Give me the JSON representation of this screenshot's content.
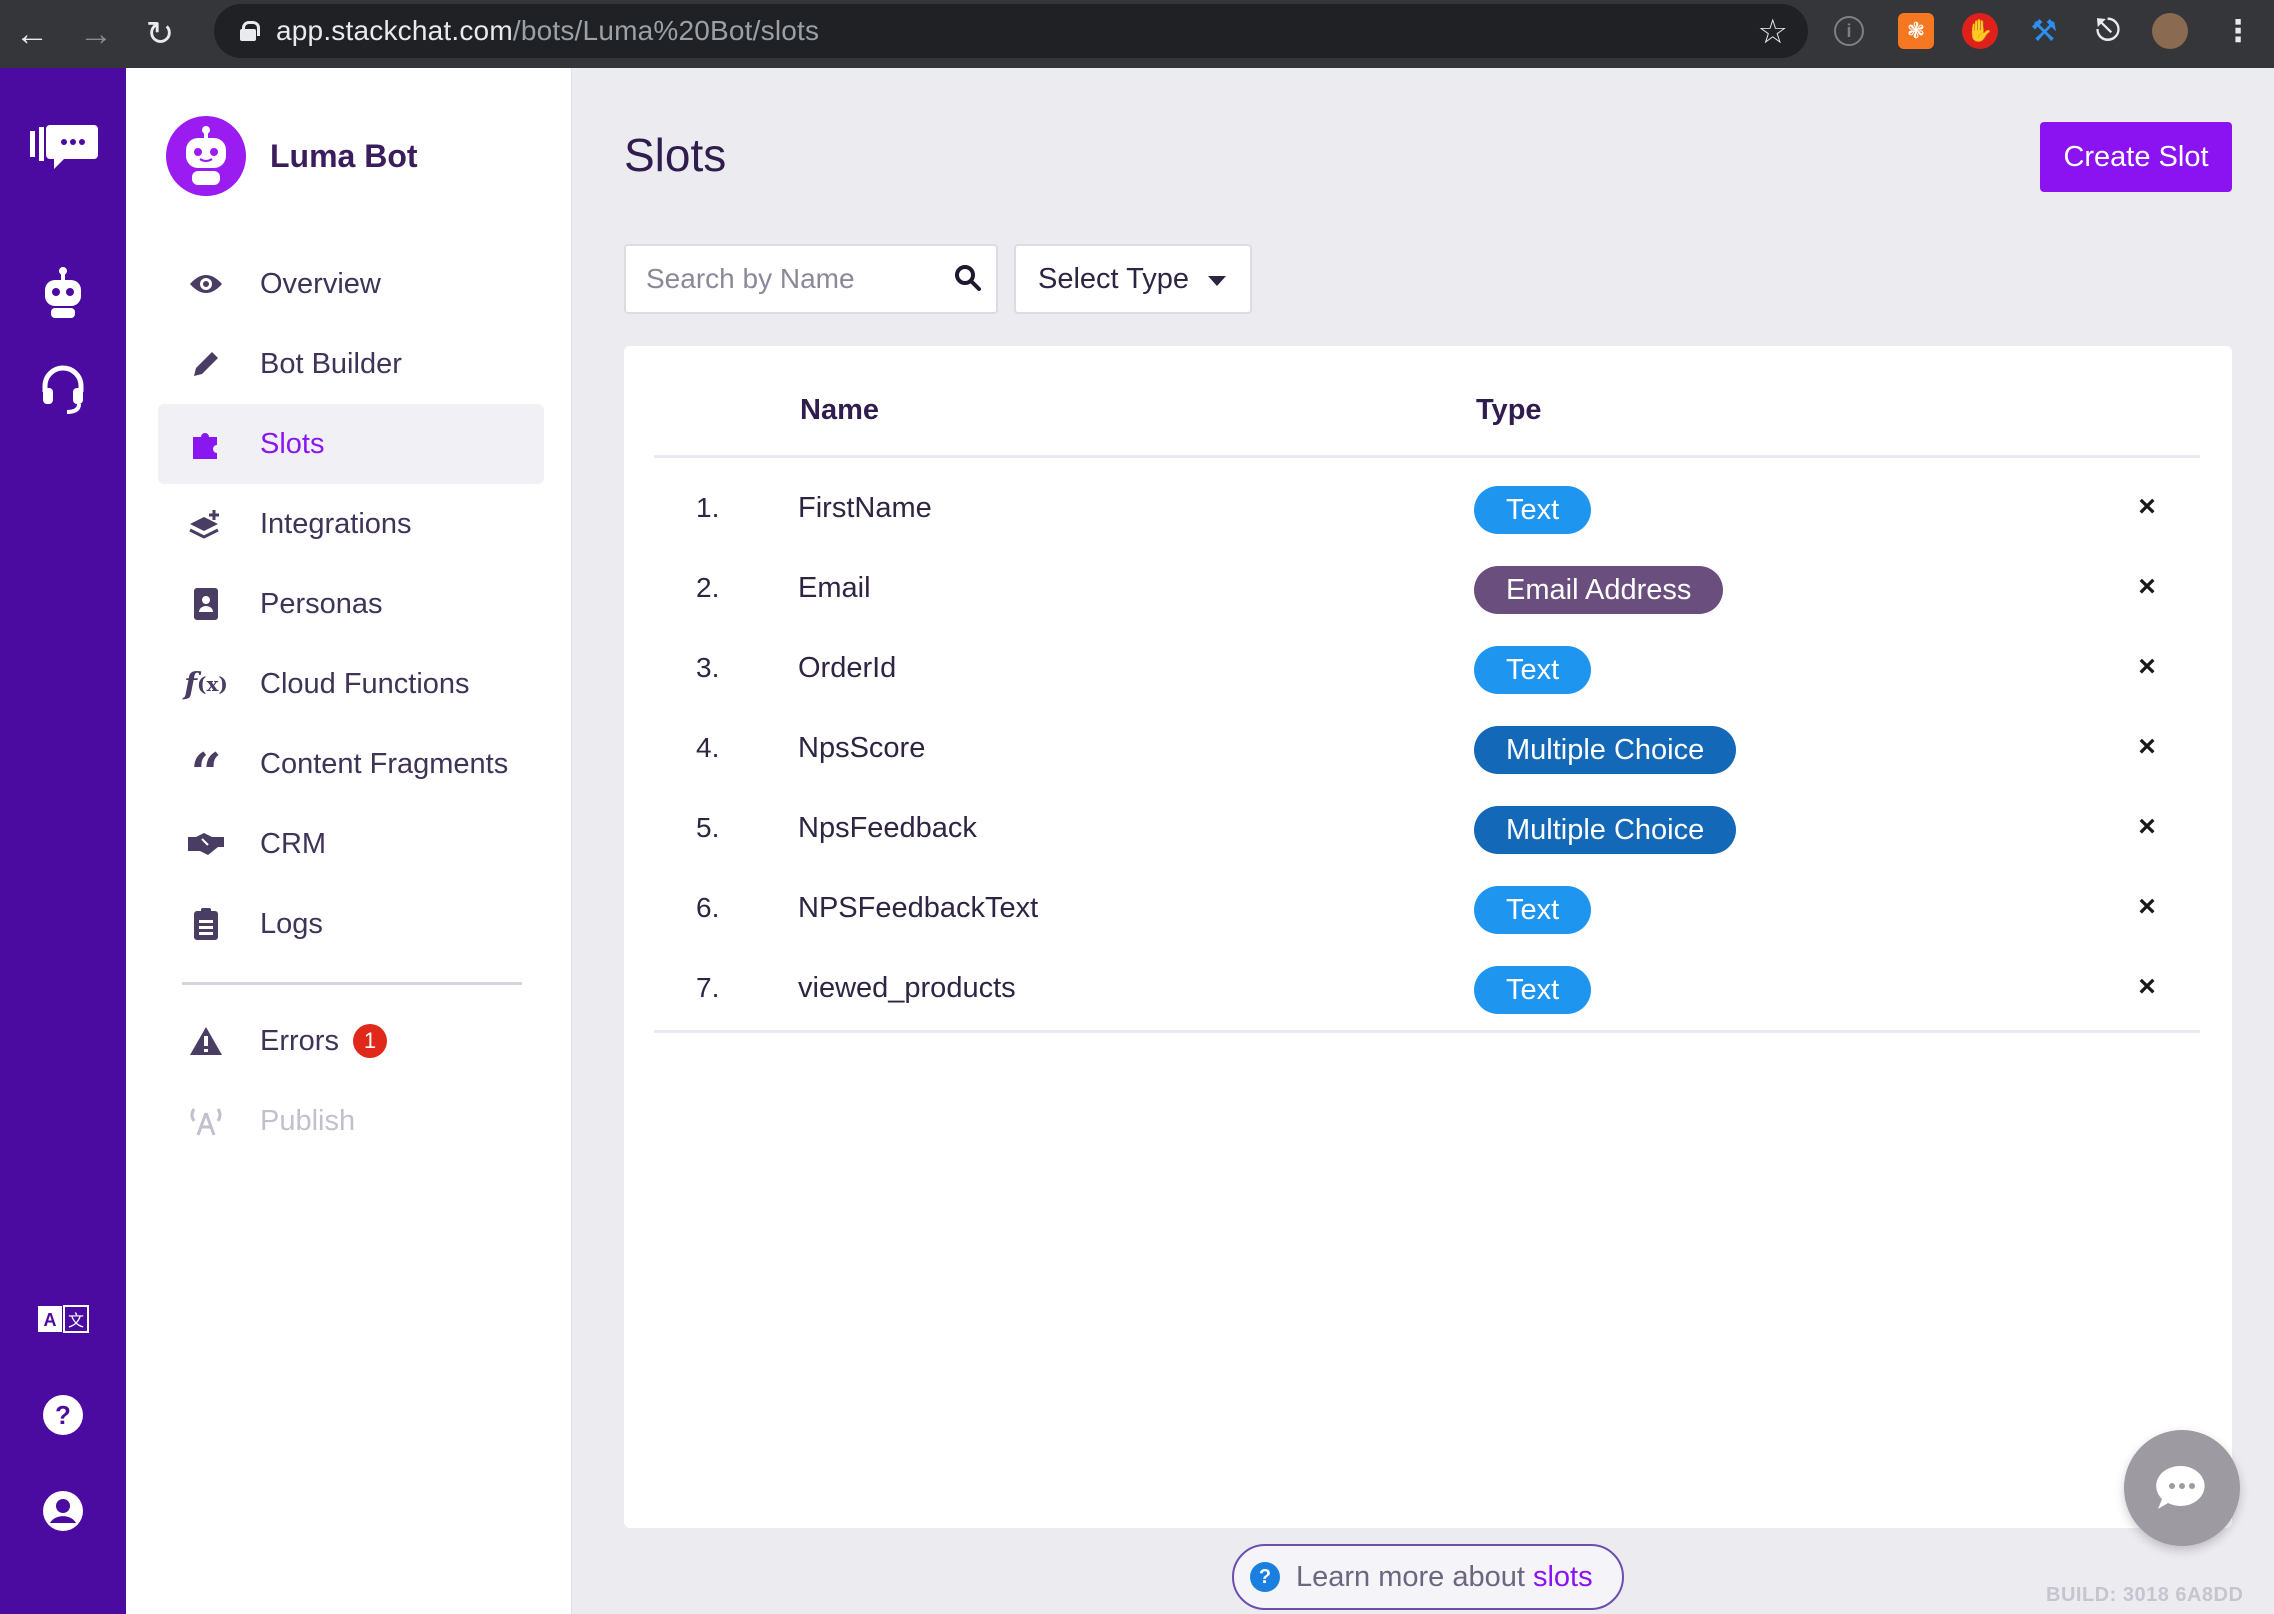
{
  "browser": {
    "url_host": "app.stackchat.com",
    "url_path": "/bots/Luma%20Bot/slots"
  },
  "bot": {
    "name": "Luma Bot"
  },
  "nav": {
    "items": [
      {
        "label": "Overview",
        "icon": "eye-icon"
      },
      {
        "label": "Bot Builder",
        "icon": "pencil-icon"
      },
      {
        "label": "Slots",
        "icon": "puzzle-icon",
        "active": true
      },
      {
        "label": "Integrations",
        "icon": "layers-plus-icon"
      },
      {
        "label": "Personas",
        "icon": "id-badge-icon"
      },
      {
        "label": "Cloud Functions",
        "icon": "function-icon"
      },
      {
        "label": "Content Fragments",
        "icon": "quote-icon"
      },
      {
        "label": "CRM",
        "icon": "handshake-icon"
      },
      {
        "label": "Logs",
        "icon": "clipboard-list-icon"
      }
    ],
    "errors": {
      "label": "Errors",
      "count": "1"
    },
    "publish": {
      "label": "Publish"
    }
  },
  "page": {
    "title": "Slots",
    "create_label": "Create Slot",
    "search_placeholder": "Search by Name",
    "select_label": "Select Type"
  },
  "table": {
    "headers": {
      "name": "Name",
      "type": "Type"
    },
    "rows": [
      {
        "num": "1.",
        "name": "FirstName",
        "type": "Text",
        "color": "#1e96f0"
      },
      {
        "num": "2.",
        "name": "Email",
        "type": "Email Address",
        "color": "#6a4f7e"
      },
      {
        "num": "3.",
        "name": "OrderId",
        "type": "Text",
        "color": "#1e96f0"
      },
      {
        "num": "4.",
        "name": "NpsScore",
        "type": "Multiple Choice",
        "color": "#1468b8"
      },
      {
        "num": "5.",
        "name": "NpsFeedback",
        "type": "Multiple Choice",
        "color": "#1468b8"
      },
      {
        "num": "6.",
        "name": "NPSFeedbackText",
        "type": "Text",
        "color": "#1e96f0"
      },
      {
        "num": "7.",
        "name": "viewed_products",
        "type": "Text",
        "color": "#1e96f0"
      }
    ],
    "delete_glyph": "×"
  },
  "footer": {
    "learn_prefix": "Learn more about",
    "learn_link": "slots",
    "build": "BUILD: 3018 6A8DD"
  },
  "colors": {
    "rail": "#4b0aa0",
    "accent": "#8b13f2"
  }
}
